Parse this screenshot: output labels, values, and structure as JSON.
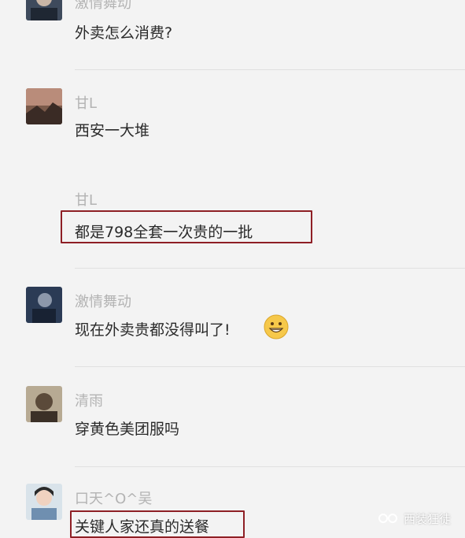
{
  "messages": [
    {
      "name": "激情舞动",
      "text": "外卖怎么消费?"
    },
    {
      "name": "甘L",
      "text": "西安一大堆"
    },
    {
      "name": "甘L",
      "text": "都是798全套一次贵的一批"
    },
    {
      "name": "激情舞动",
      "text": "现在外卖贵都没得叫了!"
    },
    {
      "name": "清雨",
      "text": "穿黄色美团服吗"
    },
    {
      "name": "口天^O^吴",
      "text": "关键人家还真的送餐"
    }
  ],
  "emoji": "grinning-face-icon",
  "watermark": {
    "text": "西装狂徒",
    "icon": "wechat-channel-icon"
  },
  "colors": {
    "highlight": "#8e1f25",
    "name": "#b3b3b3",
    "text": "#2a2a2a",
    "background": "#f3f3f3"
  }
}
